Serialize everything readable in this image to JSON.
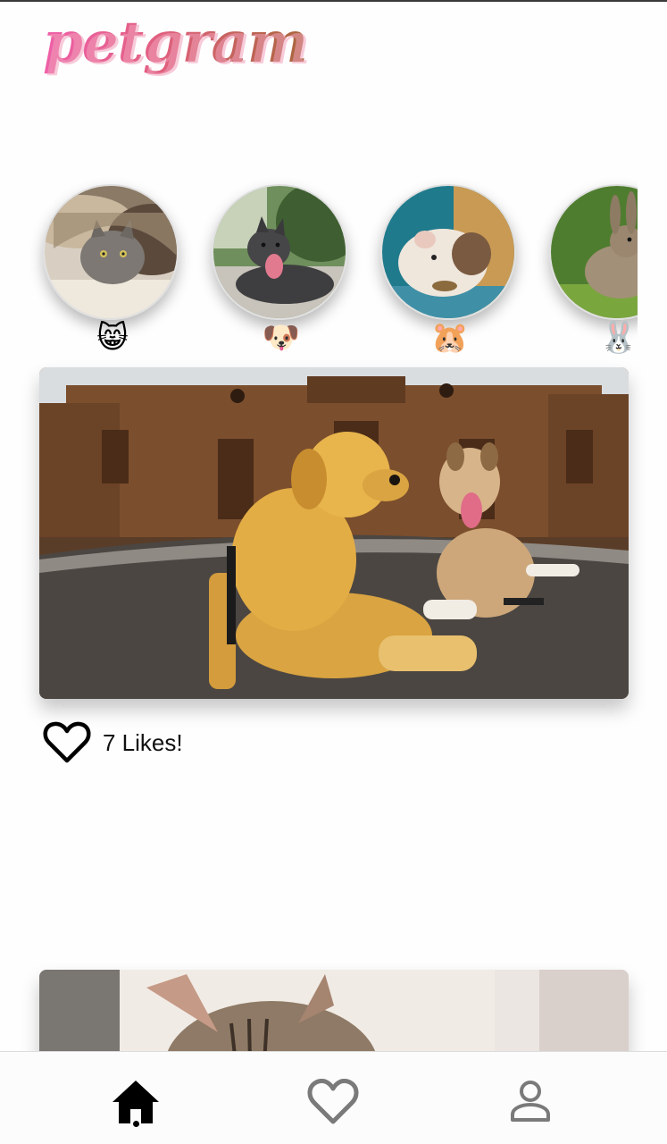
{
  "app": {
    "logo_text": "petgram"
  },
  "stories": [
    {
      "name": "cats",
      "emoji": "😸"
    },
    {
      "name": "dogs",
      "emoji": "🐶"
    },
    {
      "name": "hamsters",
      "emoji": "🐹"
    },
    {
      "name": "rabbits",
      "emoji": "🐰"
    }
  ],
  "feed": [
    {
      "image": "golden retriever and dog lying in front of cathedral",
      "likes_label": "7 Likes!"
    },
    {
      "image": "tabby cat"
    }
  ],
  "nav": {
    "items": [
      {
        "icon": "home-icon",
        "active": true
      },
      {
        "icon": "heart-outline-icon",
        "active": false
      },
      {
        "icon": "user-icon",
        "active": false
      }
    ]
  },
  "colors": {
    "logo_pink": "#ef5fa9",
    "logo_brown": "#a8663a",
    "nav_active": "#000000",
    "nav_inactive": "#7a7a7a"
  }
}
